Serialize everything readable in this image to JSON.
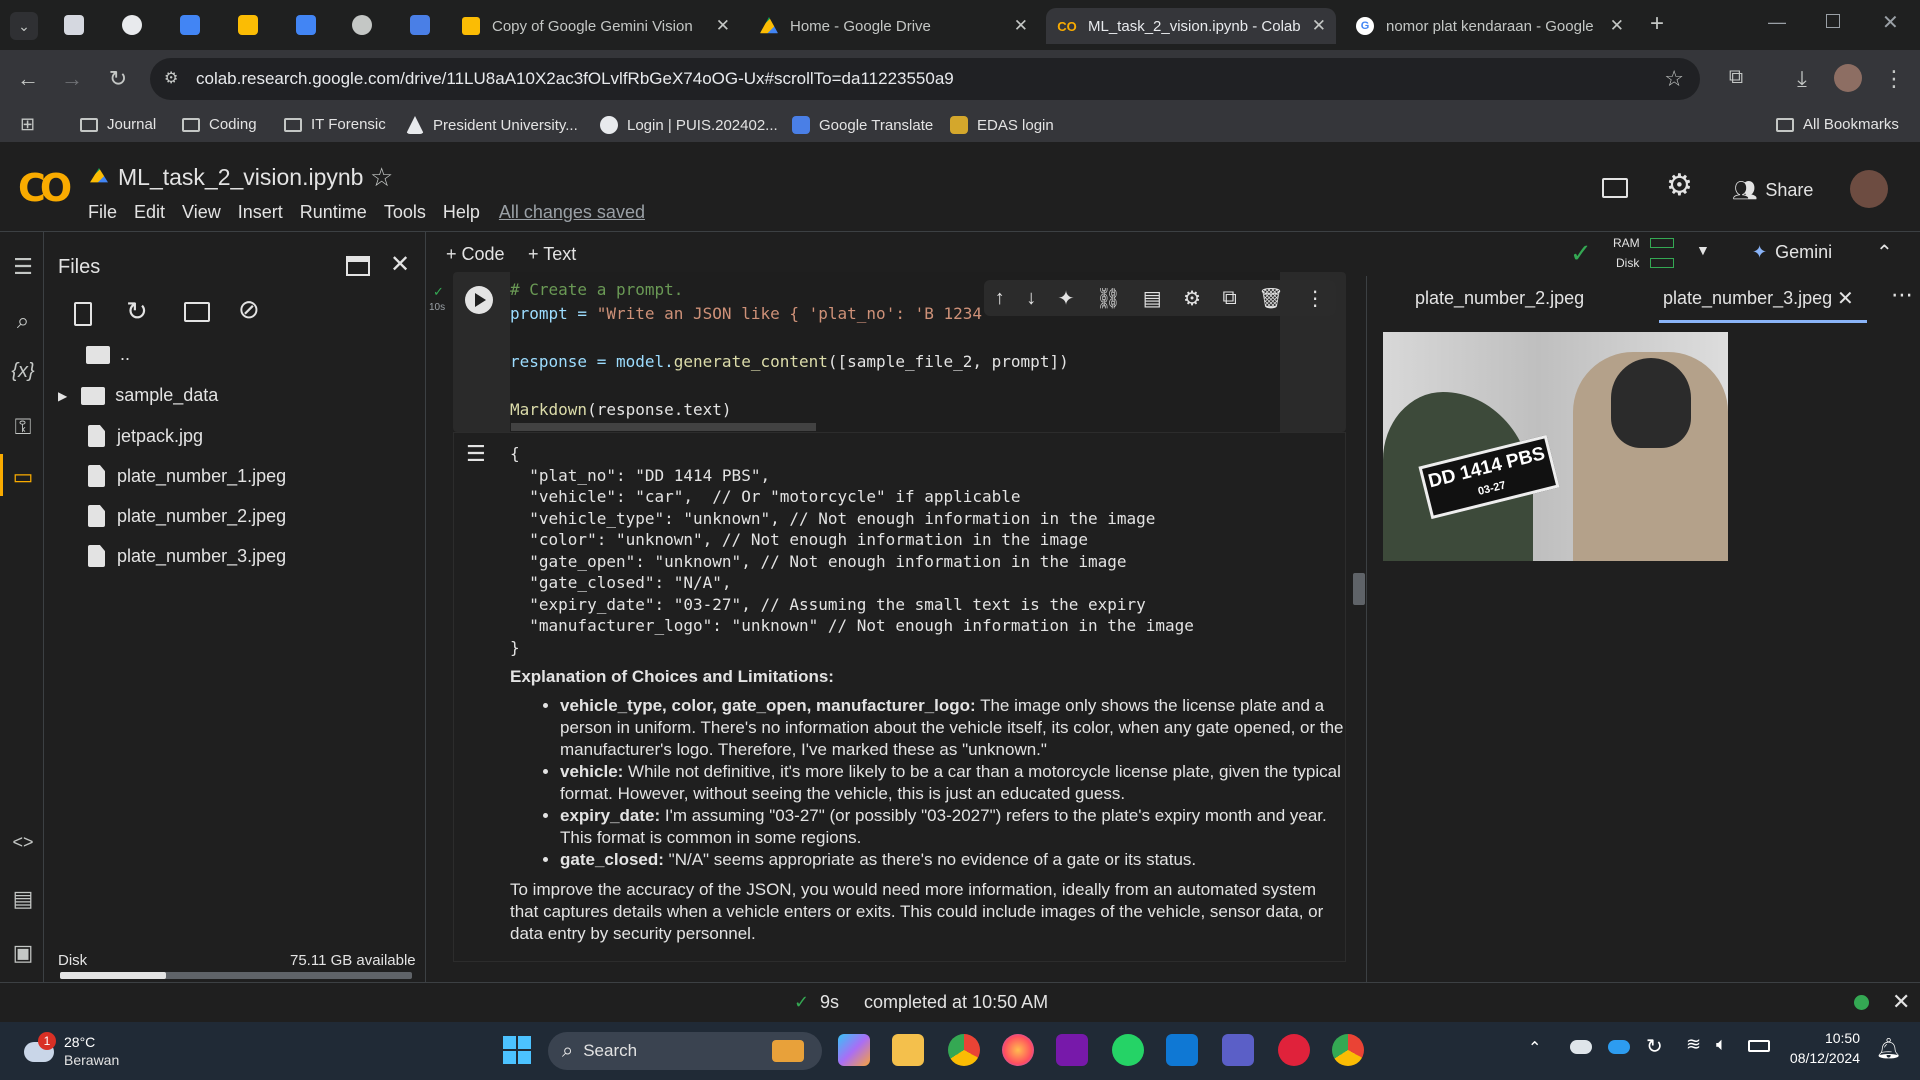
{
  "browser": {
    "tabs": [
      {
        "title": "Copy of Google Gemini Vision"
      },
      {
        "title": "Home - Google Drive"
      },
      {
        "title": "ML_task_2_vision.ipynb - Colab"
      },
      {
        "title": "nomor plat kendaraan - Google"
      }
    ],
    "url": "colab.research.google.com/drive/11LU8aA10X2ac3fOLvlfRbGeX74oOG-Ux#scrollTo=da11223550a9",
    "bookmarks": [
      "Journal",
      "Coding",
      "IT Forensic",
      "President University...",
      "Login | PUIS.202402...",
      "Google Translate",
      "EDAS login"
    ],
    "all_bookmarks": "All Bookmarks"
  },
  "colab": {
    "logo": "CO",
    "notebook_title": "ML_task_2_vision.ipynb",
    "menus": [
      "File",
      "Edit",
      "View",
      "Insert",
      "Runtime",
      "Tools",
      "Help"
    ],
    "saved_status": "All changes saved",
    "share": "Share",
    "add_code": "+ Code",
    "add_text": "+ Text",
    "ram": "RAM",
    "disk": "Disk",
    "gemini": "Gemini"
  },
  "files_panel": {
    "title": "Files",
    "items": [
      "..",
      "sample_data",
      "jetpack.jpg",
      "plate_number_1.jpeg",
      "plate_number_2.jpeg",
      "plate_number_3.jpeg"
    ],
    "disk_label": "Disk",
    "disk_available": "75.11 GB available",
    "disk_used_fraction": 0.3
  },
  "cell": {
    "exec_time": "10s",
    "code": {
      "line1": "# Create a prompt.",
      "line2_a": "prompt = ",
      "line2_b": "\"Write an JSON like { 'plat_no': 'B 1234",
      "line3_a": "response = model.",
      "line3_b": "generate_content",
      "line3_c": "([sample_file_2, prompt])",
      "line4_a": "Markdown",
      "line4_b": "(response.text)"
    }
  },
  "output": {
    "json_lines": [
      "{",
      "  \"plat_no\": \"DD 1414 PBS\",",
      "  \"vehicle\": \"car\",  // Or \"motorcycle\" if applicable",
      "  \"vehicle_type\": \"unknown\", // Not enough information in the image",
      "  \"color\": \"unknown\", // Not enough information in the image",
      "  \"gate_open\": \"unknown\", // Not enough information in the image",
      "  \"gate_closed\": \"N/A\",",
      "  \"expiry_date\": \"03-27\", // Assuming the small text is the expiry",
      "  \"manufacturer_logo\": \"unknown\" // Not enough information in the image",
      "}"
    ],
    "heading": "Explanation of Choices and Limitations:",
    "bullets": [
      {
        "key": "vehicle_type, color, gate_open, manufacturer_logo:",
        "text": " The image only shows the license plate and a person in uniform. There's no information about the vehicle itself, its color, when any gate opened, or the manufacturer's logo. Therefore, I've marked these as \"unknown.\""
      },
      {
        "key": "vehicle:",
        "text": " While not definitive, it's more likely to be a car than a motorcycle license plate, given the typical format. However, without seeing the vehicle, this is just an educated guess."
      },
      {
        "key": "expiry_date:",
        "text": " I'm assuming \"03-27\" (or possibly \"03-2027\") refers to the plate's expiry month and year. This format is common in some regions."
      },
      {
        "key": "gate_closed:",
        "text": " \"N/A\" seems appropriate as there's no evidence of a gate or its status."
      }
    ],
    "closing": "To improve the accuracy of the JSON, you would need more information, ideally from an automated system that captures details when a vehicle enters or exits. This could include images of the vehicle, sensor data, or data entry by security personnel."
  },
  "image_pane": {
    "tabs": [
      "plate_number_2.jpeg",
      "plate_number_3.jpeg"
    ],
    "plate_text": "DD 1414 PBS",
    "plate_sub": "03-27"
  },
  "status": {
    "elapsed": "9s",
    "completed": "completed at 10:50 AM"
  },
  "taskbar": {
    "weather_temp": "28°C",
    "weather_desc": "Berawan",
    "weather_badge": "1",
    "search": "Search",
    "time": "10:50",
    "date": "08/12/2024"
  },
  "colors": {
    "accent": "#f9ab00",
    "link": "#8ab4f8",
    "running_green": "#34a853"
  }
}
